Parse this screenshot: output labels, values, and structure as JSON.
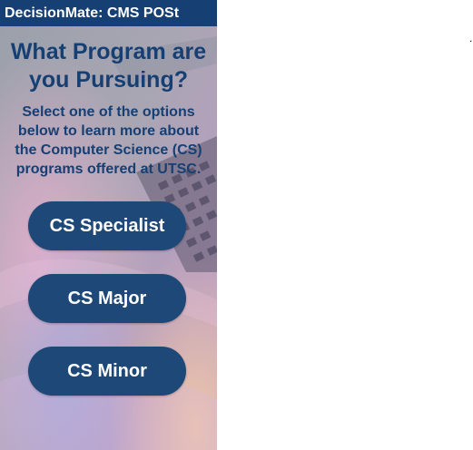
{
  "app": {
    "title": "DecisionMate: CMS POSt"
  },
  "main": {
    "heading_lines": [
      "What Program are",
      "you Pursuing?"
    ],
    "description_lines": [
      "Select one of the options",
      "below to learn more about",
      "the Computer Science (CS)",
      "programs offered at UTSC."
    ],
    "buttons": [
      {
        "label": "CS Specialist"
      },
      {
        "label": "CS Major"
      },
      {
        "label": "CS Minor"
      }
    ]
  },
  "stray_mark": ".",
  "colors": {
    "header_bg": "#163f73",
    "heading_text": "#163f73",
    "button_bg": "#1e4877",
    "button_text": "#ffffff"
  },
  "icons": {
    "background": "laptop-keyboard-photo"
  }
}
